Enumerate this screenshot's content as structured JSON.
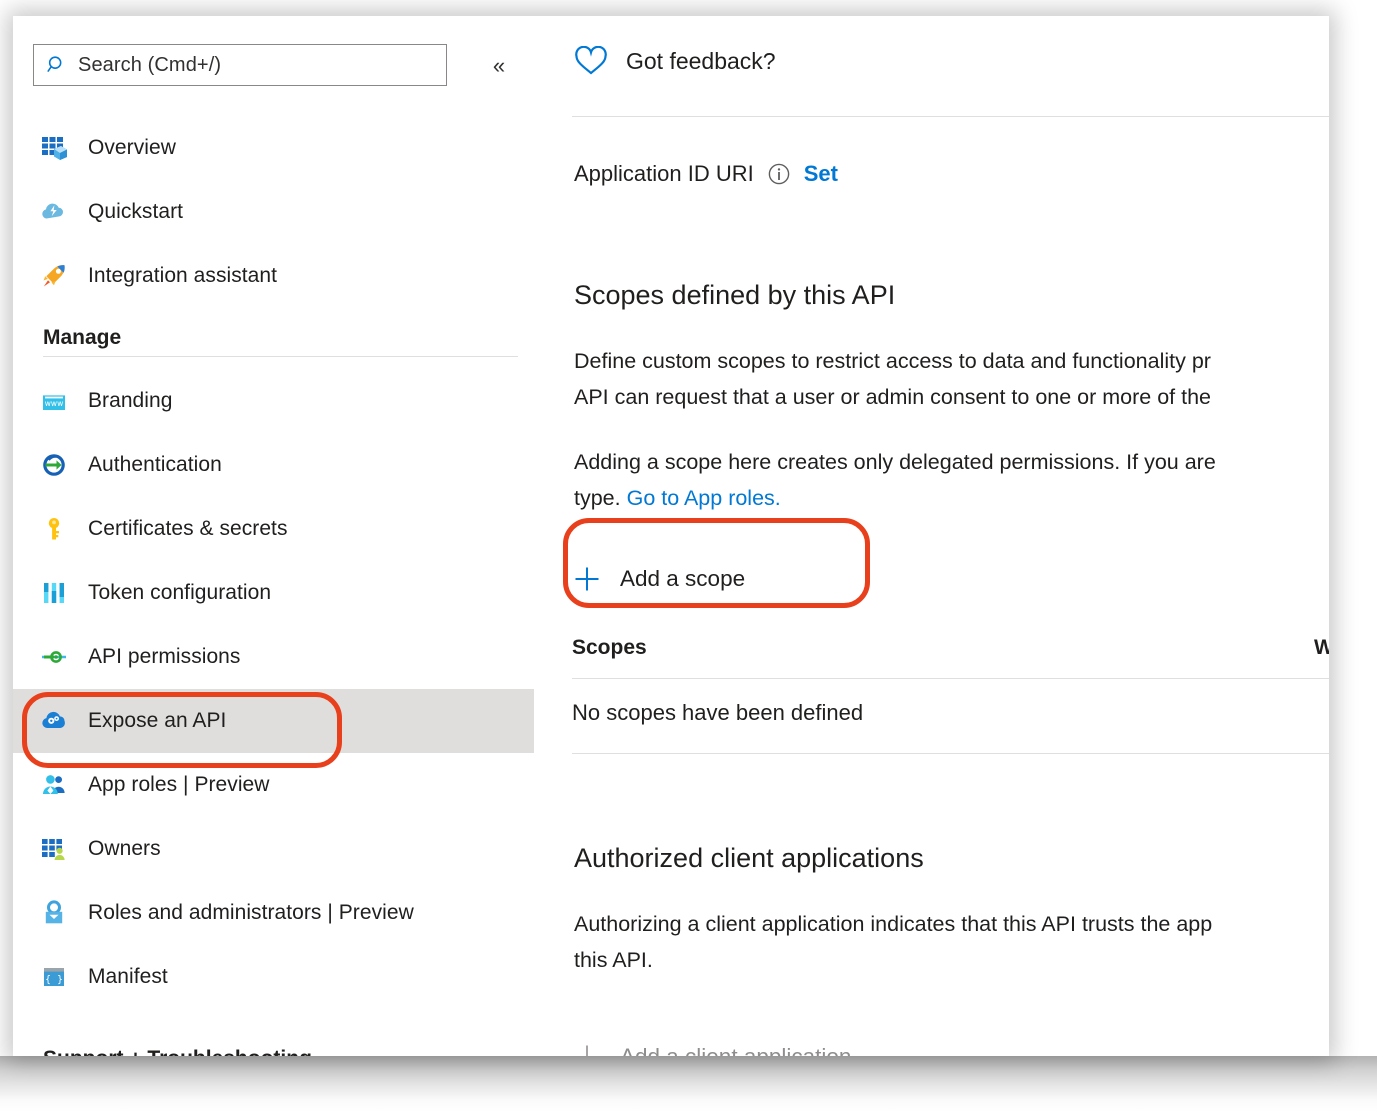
{
  "sidebar": {
    "search": {
      "placeholder": "Search (Cmd+/)",
      "icon": "search-icon"
    },
    "collapse_label": "«",
    "top_items": [
      {
        "label": "Overview",
        "icon": "overview-grid-icon"
      },
      {
        "label": "Quickstart",
        "icon": "quickstart-cloud-icon"
      },
      {
        "label": "Integration assistant",
        "icon": "rocket-icon"
      }
    ],
    "manage_group": "Manage",
    "manage_items": [
      {
        "label": "Branding",
        "icon": "branding-window-icon"
      },
      {
        "label": "Authentication",
        "icon": "authentication-arrow-icon"
      },
      {
        "label": "Certificates & secrets",
        "icon": "key-icon"
      },
      {
        "label": "Token configuration",
        "icon": "token-bars-icon"
      },
      {
        "label": "API permissions",
        "icon": "api-permissions-icon"
      },
      {
        "label": "Expose an API",
        "icon": "expose-api-cloud-gear-icon",
        "selected": true
      },
      {
        "label": "App roles | Preview",
        "icon": "app-roles-users-icon"
      },
      {
        "label": "Owners",
        "icon": "owners-grid-icon"
      },
      {
        "label": "Roles and administrators | Preview",
        "icon": "roles-admin-icon"
      },
      {
        "label": "Manifest",
        "icon": "manifest-braces-icon"
      }
    ],
    "support_group": "Support + Troubleshooting"
  },
  "content": {
    "feedback": {
      "label": "Got feedback?",
      "icon": "heart-icon"
    },
    "app_id_uri": {
      "label": "Application ID URI",
      "info_icon": "info-icon",
      "action": "Set"
    },
    "scopes_section": {
      "title": "Scopes defined by this API",
      "paragraph1_line1": "Define custom scopes to restrict access to data and functionality pr",
      "paragraph1_line2": "API can request that a user or admin consent to one or more of the",
      "paragraph2_line1": "Adding a scope here creates only delegated permissions. If you are",
      "paragraph2_line2_prefix": "type. ",
      "paragraph2_link": "Go to App roles.",
      "add_scope_button": "Add a scope",
      "table": {
        "columns": [
          "Scopes",
          "Wh"
        ],
        "empty_message": "No scopes have been defined"
      }
    },
    "authorized_section": {
      "title": "Authorized client applications",
      "paragraph_line1": "Authorizing a client application indicates that this API trusts the app",
      "paragraph_line2": "this API.",
      "add_client_button": "Add a client application"
    }
  },
  "annotations": {
    "color": "#e8401c",
    "targets": [
      "Expose an API",
      "Add a scope"
    ]
  }
}
